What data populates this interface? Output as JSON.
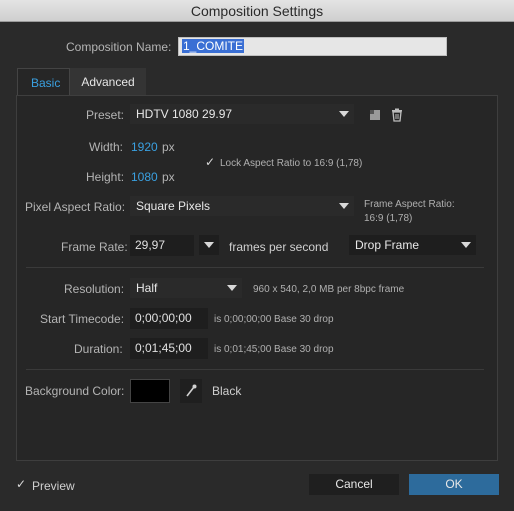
{
  "window": {
    "title": "Composition Settings"
  },
  "composition_name": {
    "label": "Composition Name:",
    "value": "1_COMITE"
  },
  "tabs": [
    {
      "label": "Basic",
      "active": true
    },
    {
      "label": "Advanced",
      "active": false
    }
  ],
  "preset": {
    "label": "Preset:",
    "value": "HDTV 1080 29.97"
  },
  "width": {
    "label": "Width:",
    "value": "1920",
    "unit": "px"
  },
  "height": {
    "label": "Height:",
    "value": "1080",
    "unit": "px"
  },
  "lock_aspect": {
    "checked": true,
    "label": "Lock Aspect Ratio to 16:9 (1,78)"
  },
  "pixel_aspect": {
    "label": "Pixel Aspect Ratio:",
    "value": "Square Pixels",
    "frame_aspect_label": "Frame Aspect Ratio:",
    "frame_aspect_value": "16:9 (1,78)"
  },
  "frame_rate": {
    "label": "Frame Rate:",
    "value": "29,97",
    "unit_text": "frames per second",
    "drop": "Drop Frame"
  },
  "resolution": {
    "label": "Resolution:",
    "value": "Half",
    "info": "960 x 540, 2,0 MB per 8bpc frame"
  },
  "start_timecode": {
    "label": "Start Timecode:",
    "value": "0;00;00;00",
    "info": "is 0;00;00;00  Base 30  drop"
  },
  "duration": {
    "label": "Duration:",
    "value": "0;01;45;00",
    "info": "is 0;01;45;00  Base 30  drop"
  },
  "background_color": {
    "label": "Background Color:",
    "name": "Black",
    "hex": "#000000"
  },
  "footer": {
    "preview_checked": true,
    "preview_label": "Preview",
    "cancel_label": "Cancel",
    "ok_label": "OK"
  },
  "colors": {
    "accent": "#3aa0e0",
    "ok_button": "#2d6b9c",
    "panel_bg": "#262626"
  }
}
